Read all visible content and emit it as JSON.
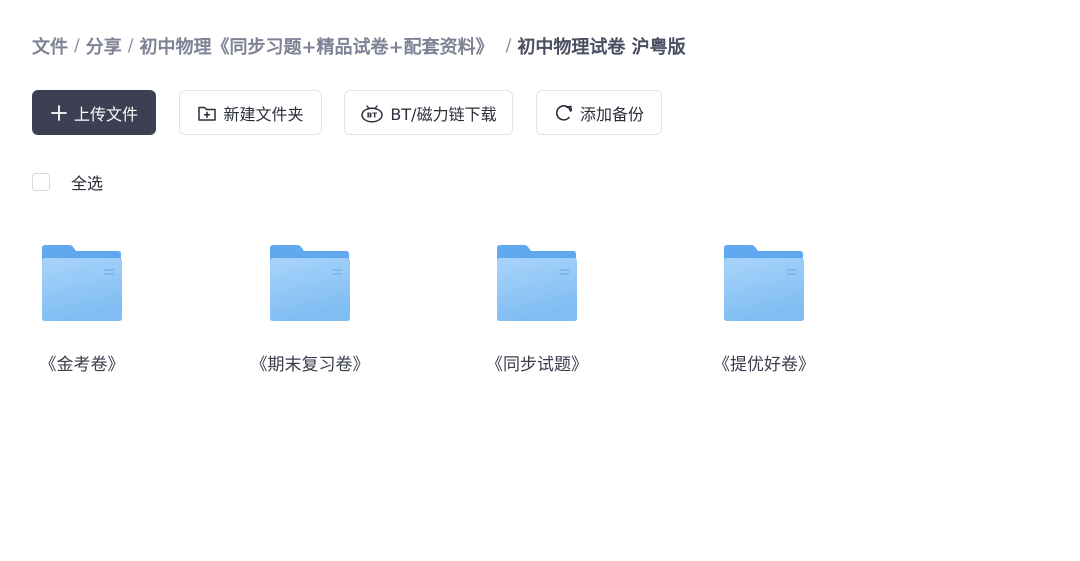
{
  "breadcrumb": {
    "items": [
      "文件",
      "分享",
      "初中物理《同步习题+精品试卷+配套资料》"
    ],
    "current": "初中物理试卷 沪粤版",
    "separator": "/"
  },
  "toolbar": {
    "upload_label": "上传文件",
    "new_folder_label": "新建文件夹",
    "bt_download_label": "BT/磁力链下载",
    "add_backup_label": "添加备份"
  },
  "selection": {
    "select_all_label": "全选",
    "checked": false
  },
  "folders": [
    {
      "name": "《金考卷》",
      "icon": "folder-icon"
    },
    {
      "name": "《期末复习卷》",
      "icon": "folder-icon"
    },
    {
      "name": "《同步试题》",
      "icon": "folder-icon"
    },
    {
      "name": "《提优好卷》",
      "icon": "folder-icon"
    }
  ],
  "colors": {
    "primary_button": "#3d3f52",
    "breadcrumb_text": "#7e8294",
    "folder_blue": "#8cc6f5"
  }
}
